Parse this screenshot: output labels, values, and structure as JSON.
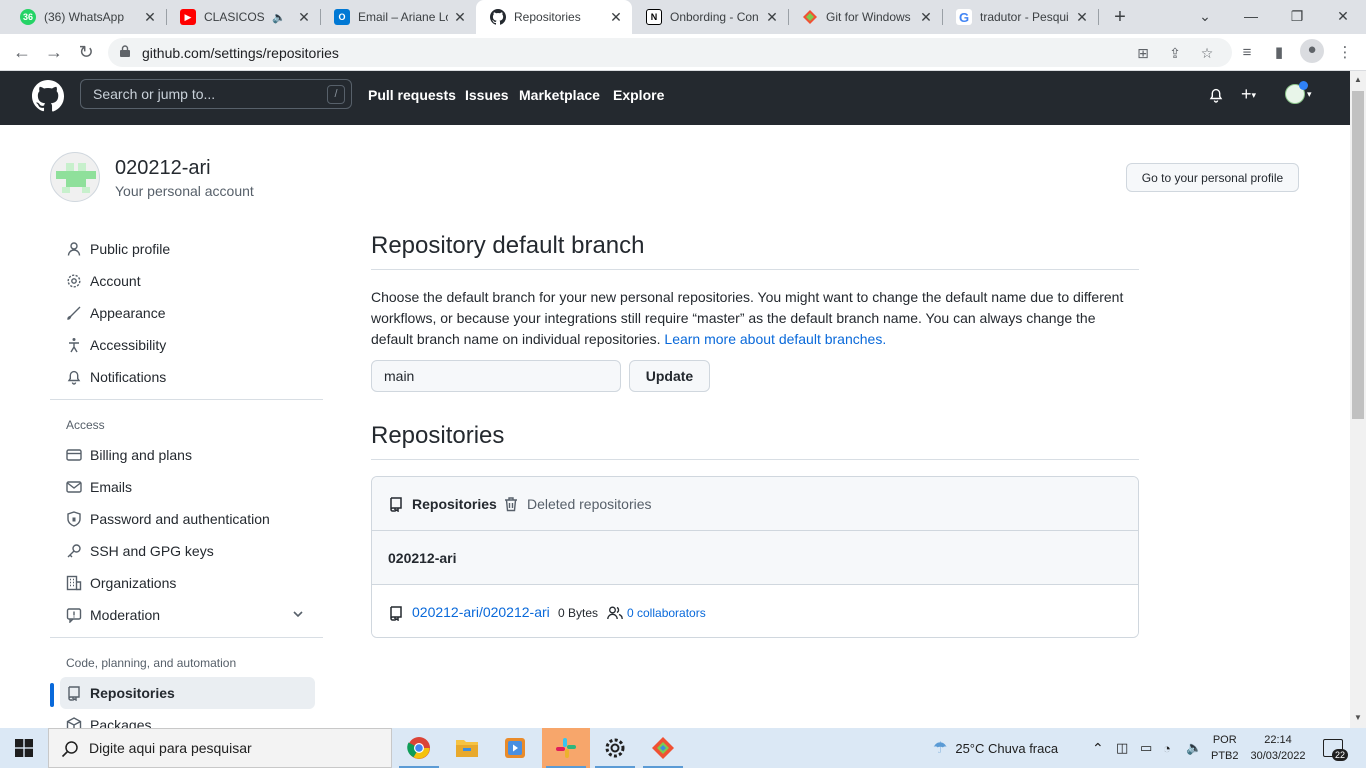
{
  "browser": {
    "tabs": [
      {
        "title": "(36) WhatsApp",
        "badge": "36",
        "icon": "whatsapp-icon",
        "color": "#25d366"
      },
      {
        "title": "CLASICOS LE",
        "icon": "youtube-icon",
        "color": "#ff0000",
        "audio": true
      },
      {
        "title": "Email – Ariane Lo",
        "icon": "outlook-icon",
        "color": "#0078d4"
      },
      {
        "title": "Repositories",
        "icon": "github-icon",
        "color": "#24292f",
        "active": true
      },
      {
        "title": "Onbording - Con",
        "icon": "notion-icon",
        "color": "#000000"
      },
      {
        "title": "Git for Windows",
        "icon": "git-for-windows-icon",
        "color": "#f05133"
      },
      {
        "title": "tradutor - Pesqui",
        "icon": "google-icon",
        "color": "#4285f4"
      }
    ],
    "url": "github.com/settings/repositories"
  },
  "github": {
    "search_placeholder": "Search or jump to...",
    "search_shortcut": "/",
    "nav": [
      "Pull requests",
      "Issues",
      "Marketplace",
      "Explore"
    ]
  },
  "account": {
    "name": "020212-ari",
    "subtitle": "Your personal account",
    "profile_button": "Go to your personal profile"
  },
  "sidebar": {
    "top_items": [
      {
        "label": "Public profile",
        "icon": "person-icon"
      },
      {
        "label": "Account",
        "icon": "gear-icon"
      },
      {
        "label": "Appearance",
        "icon": "paintbrush-icon"
      },
      {
        "label": "Accessibility",
        "icon": "accessibility-icon"
      },
      {
        "label": "Notifications",
        "icon": "bell-icon"
      }
    ],
    "access_heading": "Access",
    "access_items": [
      {
        "label": "Billing and plans",
        "icon": "credit-card-icon"
      },
      {
        "label": "Emails",
        "icon": "mail-icon"
      },
      {
        "label": "Password and authentication",
        "icon": "shield-lock-icon"
      },
      {
        "label": "SSH and GPG keys",
        "icon": "key-icon"
      },
      {
        "label": "Organizations",
        "icon": "organization-icon"
      },
      {
        "label": "Moderation",
        "icon": "report-icon"
      }
    ],
    "code_heading": "Code, planning, and automation",
    "code_items": [
      {
        "label": "Repositories",
        "icon": "repo-icon",
        "active": true
      },
      {
        "label": "Packages",
        "icon": "package-icon"
      }
    ]
  },
  "main": {
    "default_branch": {
      "title": "Repository default branch",
      "description": "Choose the default branch for your new personal repositories. You might want to change the default name due to different workflows, or because your integrations still require “master” as the default branch name. You can always change the default branch name on individual repositories.",
      "learn_more": "Learn more about default branches.",
      "input_value": "main",
      "update_button": "Update"
    },
    "repositories": {
      "title": "Repositories",
      "tabs": [
        {
          "label": "Repositories",
          "icon": "repo-icon",
          "selected": true
        },
        {
          "label": "Deleted repositories",
          "icon": "trash-icon",
          "selected": false
        }
      ],
      "owner": "020212-ari",
      "items": [
        {
          "name": "020212-ari/020212-ari",
          "size": "0 Bytes",
          "collaborators": "0 collaborators"
        }
      ]
    }
  },
  "taskbar": {
    "search_placeholder": "Digite aqui para pesquisar",
    "weather": "25°C  Chuva fraca",
    "language": "POR",
    "layout": "PTB2",
    "time": "22:14",
    "date": "30/03/2022",
    "notifications": "22"
  },
  "colors": {
    "accent": "#0969da",
    "header_bg": "#24292f",
    "taskbar_bg": "#dbe8f5"
  }
}
